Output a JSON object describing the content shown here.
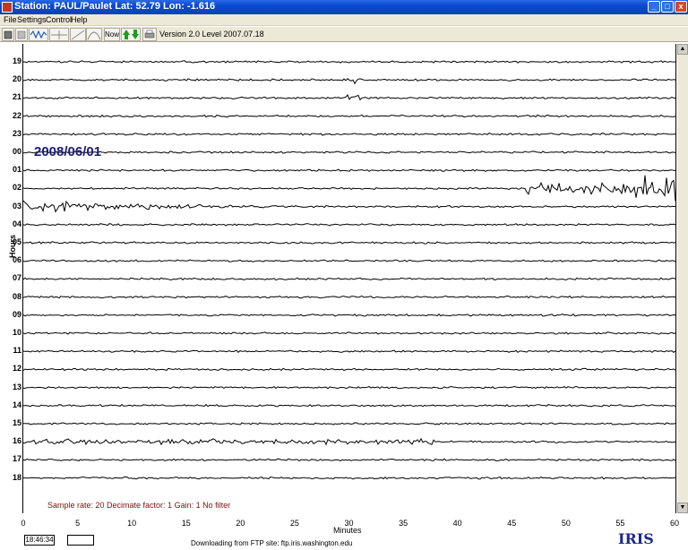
{
  "window": {
    "title": "Station: PAUL/Paulet Lat: 52.79 Lon: -1.616",
    "min": "_",
    "max": "□",
    "close": "x"
  },
  "menu": {
    "items": [
      "File",
      "Settings",
      "Control",
      "Help"
    ]
  },
  "toolbar": {
    "now_label": "Now",
    "version": "Version 2.0 Level 2007.07.18"
  },
  "plot": {
    "date": "2008/06/01",
    "y_axis_label": "Hours",
    "x_axis_label": "Minutes",
    "settings": "Sample rate: 20   Decimate factor: 1   Gain: 1   No filter",
    "hours": [
      "19",
      "20",
      "21",
      "22",
      "23",
      "00",
      "01",
      "02",
      "03",
      "04",
      "05",
      "06",
      "07",
      "08",
      "09",
      "10",
      "11",
      "12",
      "13",
      "14",
      "15",
      "16",
      "17",
      "18"
    ],
    "x_ticks": [
      "0",
      "5",
      "10",
      "15",
      "20",
      "25",
      "30",
      "35",
      "40",
      "45",
      "50",
      "55",
      "60"
    ]
  },
  "status": {
    "time": "18:46:34",
    "message": "Downloading from FTP site: ftp.iris.washington.edu",
    "logo": "IRIS"
  }
}
